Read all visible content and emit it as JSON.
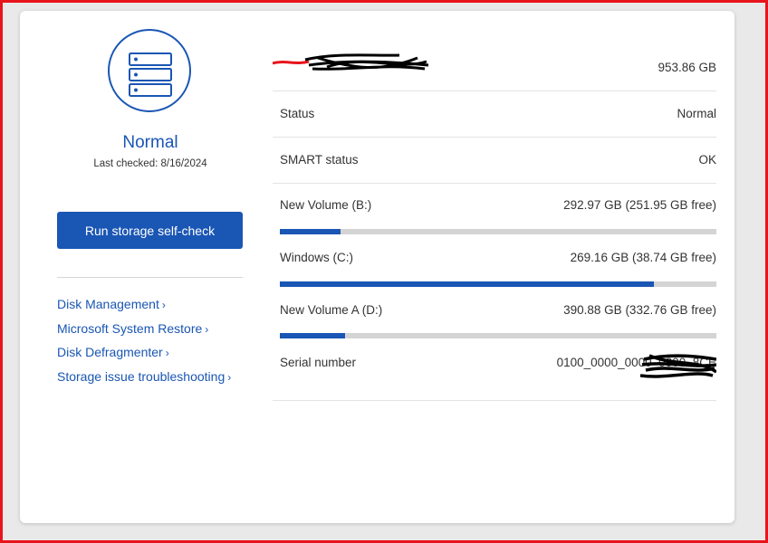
{
  "left_panel": {
    "status_title": "Normal",
    "last_checked": "Last checked: 8/16/2024",
    "run_button": "Run storage self-check",
    "links": [
      {
        "label": "Disk Management",
        "name": "link-disk-management"
      },
      {
        "label": "Microsoft System Restore",
        "name": "link-microsoft-system-restore"
      },
      {
        "label": "Disk Defragmenter",
        "name": "link-disk-defragmenter"
      },
      {
        "label": "Storage issue troubleshooting",
        "name": "link-storage-troubleshooting"
      }
    ],
    "link_chevron": "›"
  },
  "drive": {
    "capacity": "953.86 GB"
  },
  "details": {
    "status_label": "Status",
    "status_value": "Normal",
    "smart_label": "SMART status",
    "smart_value": "OK",
    "serial_label": "Serial number",
    "serial_value": "0100_0000_0000_0000_8CE"
  },
  "volumes": [
    {
      "label": "New Volume (B:)",
      "value": "292.97 GB (251.95 GB free)",
      "used_fraction": 0.14
    },
    {
      "label": "Windows (C:)",
      "value": "269.16 GB (38.74 GB free)",
      "used_fraction": 0.856
    },
    {
      "label": "New Volume A (D:)",
      "value": "390.88 GB (332.76 GB free)",
      "used_fraction": 0.149
    }
  ],
  "colors": {
    "accent": "#1a56b4",
    "frame": "#e8141b",
    "bar_track": "#d4d4d4"
  }
}
